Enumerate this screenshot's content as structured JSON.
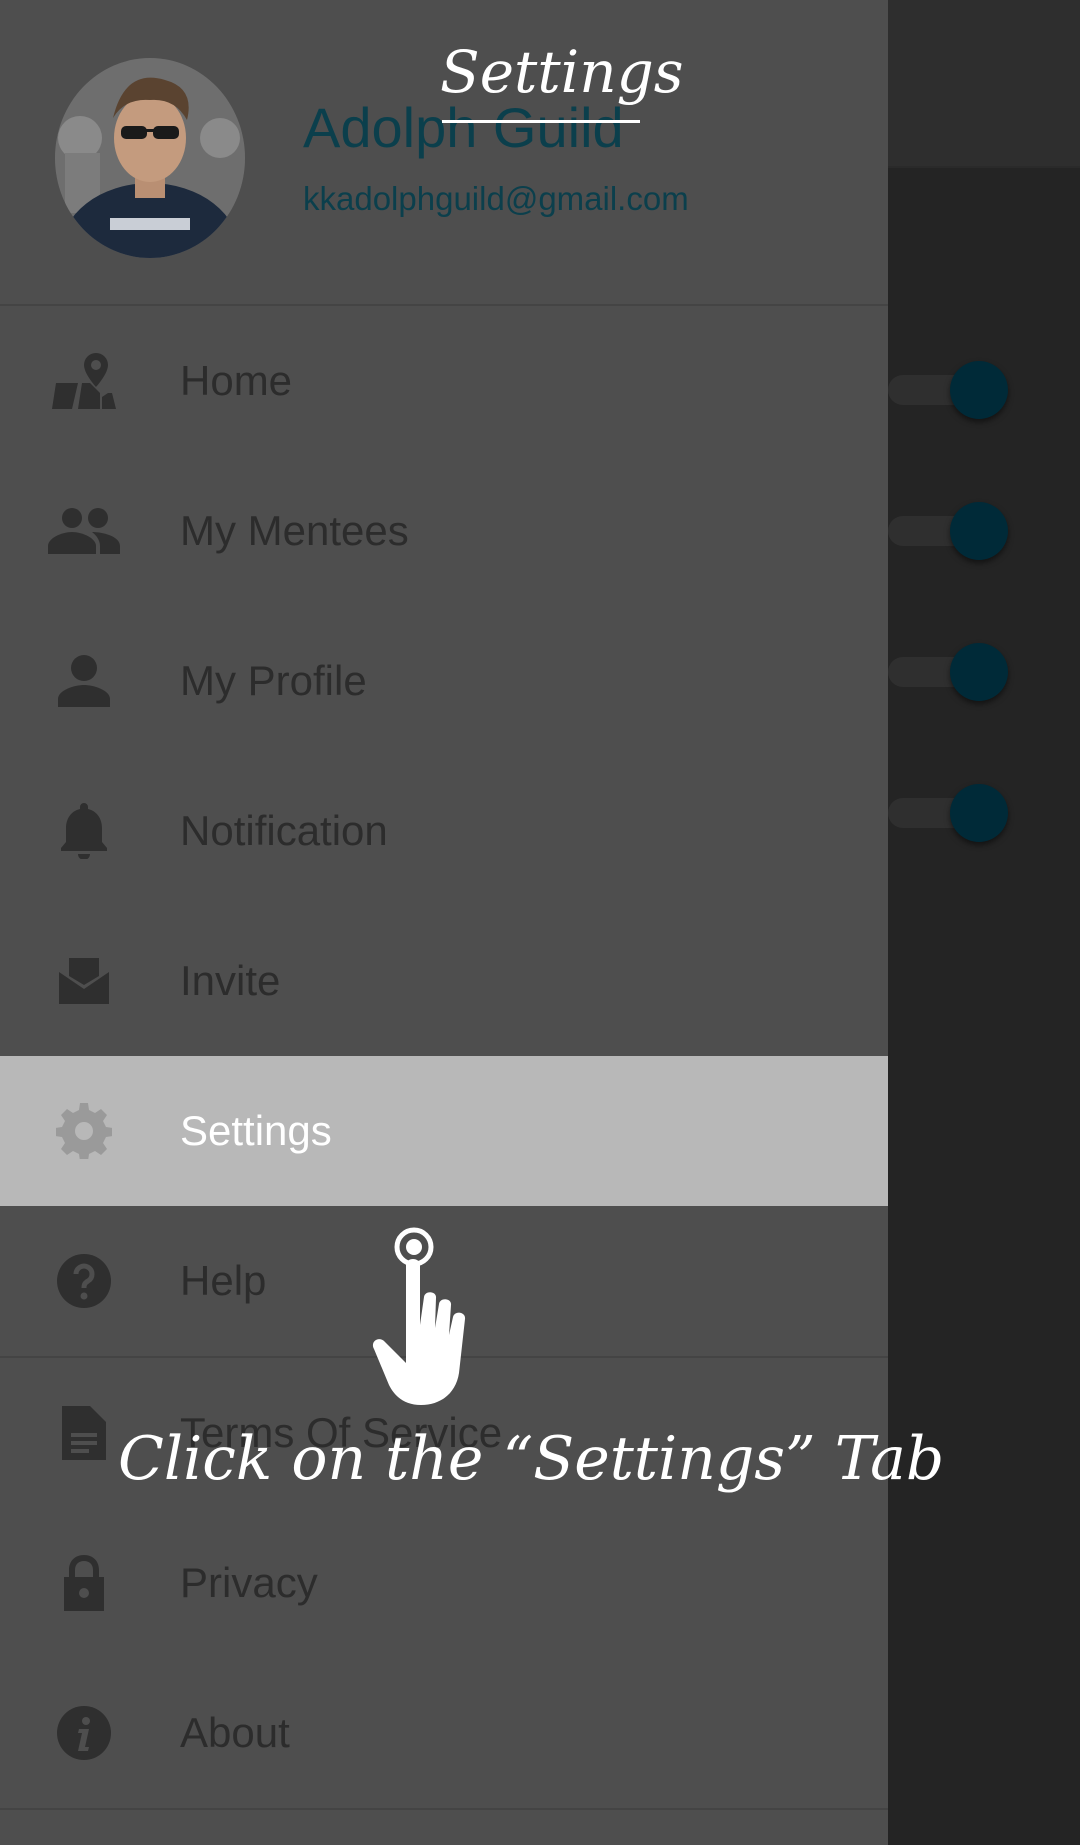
{
  "annotation": {
    "title": "Settings",
    "caption": "Click on the “Settings” Tab"
  },
  "profile": {
    "name": "Adolph Guild",
    "email": "kkadolphguild@gmail.com"
  },
  "menu": {
    "items": [
      {
        "label": "Home",
        "icon": "map-marker-icon"
      },
      {
        "label": "My Mentees",
        "icon": "people-icon"
      },
      {
        "label": "My Profile",
        "icon": "person-icon"
      },
      {
        "label": "Notification",
        "icon": "bell-icon"
      },
      {
        "label": "Invite",
        "icon": "mail-open-icon"
      },
      {
        "label": "Settings",
        "icon": "gear-icon",
        "active": true
      },
      {
        "label": "Help",
        "icon": "help-icon"
      },
      {
        "label": "Terms Of Service",
        "icon": "document-icon"
      },
      {
        "label": "Privacy",
        "icon": "lock-icon"
      },
      {
        "label": "About",
        "icon": "info-icon"
      }
    ]
  },
  "background_toggles": [
    true,
    true,
    true,
    true
  ],
  "colors": {
    "drawer": "#4e4e4e",
    "active_item": "#b8b8b8",
    "accent": "#0b3f4c"
  }
}
